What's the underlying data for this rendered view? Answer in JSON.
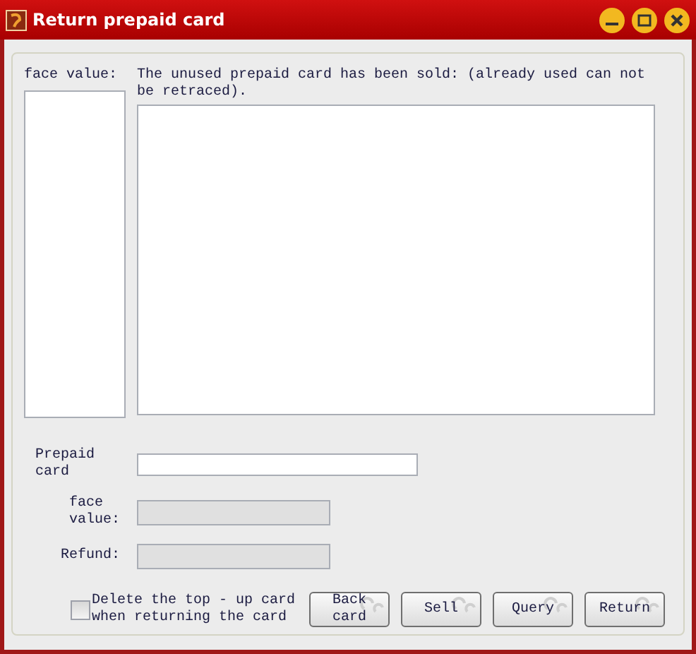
{
  "window": {
    "title": "Return prepaid card"
  },
  "face_value_list": {
    "label": "face value:"
  },
  "sold_cards_list": {
    "label": "The unused prepaid card has been sold: (already used can not be retraced)."
  },
  "fields": [
    {
      "label": "Prepaid card",
      "disabled": false
    },
    {
      "label": "face value:",
      "disabled": true
    },
    {
      "label": "Refund:",
      "disabled": true
    }
  ],
  "delete_checkbox": {
    "label": "Delete the top - up card when returning the card",
    "checked": false
  },
  "buttons": [
    "Back card",
    "Sell",
    "Query",
    "Return"
  ]
}
